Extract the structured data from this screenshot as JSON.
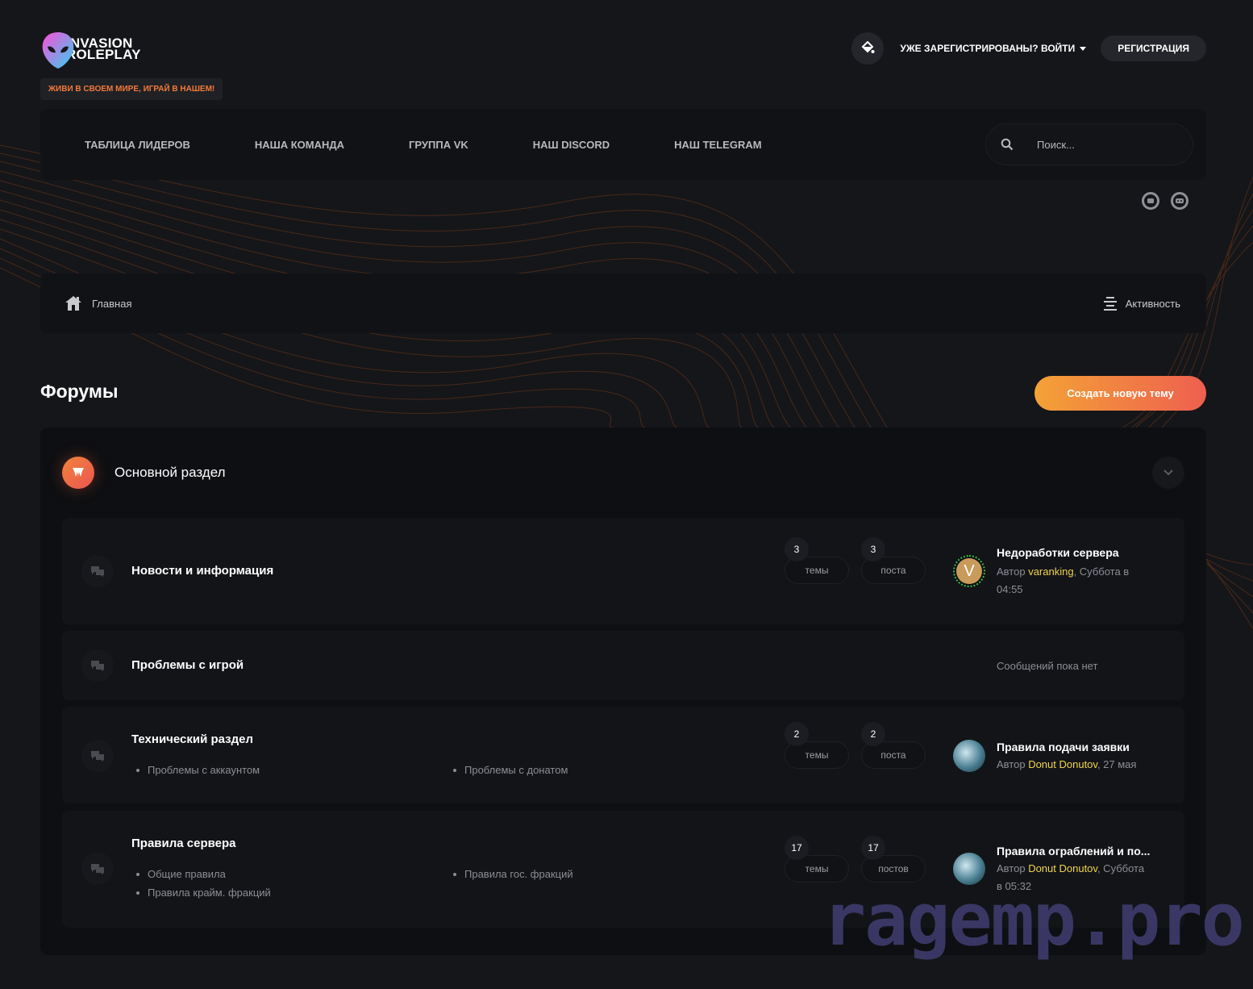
{
  "brand": {
    "logo_line1": "INVASION",
    "logo_line2": "ROLEPLAY",
    "slogan": "ЖИВИ В СВОЕМ МИРЕ, ИГРАЙ В НАШЕМ!"
  },
  "user_bar": {
    "theme_icon": "paint-bucket-icon",
    "signin_label": "УЖЕ ЗАРЕГИСТРИРОВАНЫ? ВОЙТИ",
    "register_label": "РЕГИСТРАЦИЯ"
  },
  "nav": {
    "items": [
      {
        "label": "ТАБЛИЦА ЛИДЕРОВ"
      },
      {
        "label": "НАША КОМАНДА"
      },
      {
        "label": "ГРУППА VK"
      },
      {
        "label": "НАШ DISCORD"
      },
      {
        "label": "НАШ TELEGRAM"
      }
    ],
    "search_placeholder": "Поиск..."
  },
  "breadcrumb": {
    "home_label": "Главная",
    "activity_label": "Активность"
  },
  "page": {
    "title": "Форумы",
    "new_topic_label": "Создать новую тему"
  },
  "category": {
    "title": "Основной раздел",
    "forums": [
      {
        "title": "Новости и информация",
        "topics": "3",
        "topics_label": "темы",
        "posts": "3",
        "posts_label": "поста",
        "last_title": "Недоработки сервера",
        "last_prefix": "Автор",
        "last_author": "varanking",
        "last_time": ", Суббота в 04:55",
        "avatar_letter": "V"
      },
      {
        "title": "Проблемы с игрой",
        "no_posts": "Сообщений пока нет"
      },
      {
        "title": "Технический раздел",
        "subforums": [
          "Проблемы с аккаунтом",
          "Проблемы с донатом"
        ],
        "topics": "2",
        "topics_label": "темы",
        "posts": "2",
        "posts_label": "поста",
        "last_title": "Правила подачи заявки",
        "last_prefix": "Автор",
        "last_author": "Donut Donutov",
        "last_time": ", 27 мая"
      },
      {
        "title": "Правила сервера",
        "subforums": [
          "Общие правила",
          "Правила гос. фракций",
          "Правила крайм. фракций"
        ],
        "topics": "17",
        "topics_label": "темы",
        "posts": "17",
        "posts_label": "постов",
        "last_title": "Правила ограблений и по...",
        "last_prefix": "Автор",
        "last_author": "Donut Donutov",
        "last_time": ", Суббота в 05:32"
      }
    ]
  },
  "watermark": "ragemp.pro",
  "colors": {
    "accent_start": "#f4a236",
    "accent_end": "#ee5f4f",
    "author": "#f0d44c",
    "slogan": "#f27a3a"
  }
}
